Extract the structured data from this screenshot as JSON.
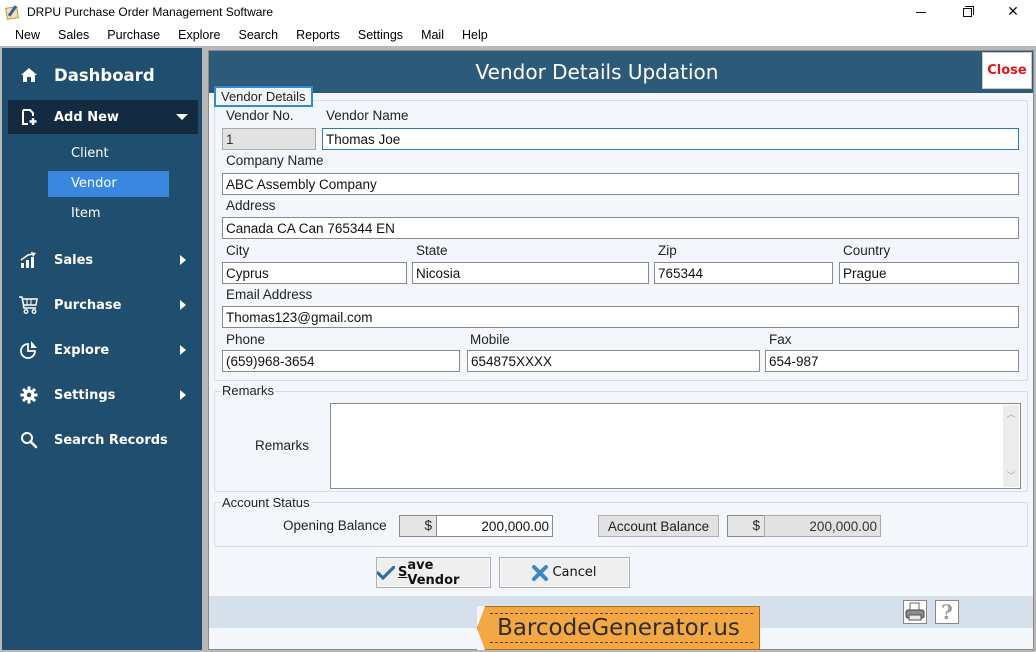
{
  "window": {
    "title": "DRPU Purchase Order Management Software",
    "controls": {
      "minimize": "minimize",
      "maximize": "restore",
      "close": "✕"
    }
  },
  "menubar": {
    "items": [
      "New",
      "Sales",
      "Purchase",
      "Explore",
      "Search",
      "Reports",
      "Settings",
      "Mail",
      "Help"
    ]
  },
  "sidebar": {
    "dashboard": "Dashboard",
    "add_new": "Add New",
    "add_new_items": [
      "Client",
      "Vendor",
      "Item"
    ],
    "selected_sub_item": "Vendor",
    "items": [
      {
        "label": "Sales",
        "icon": "chart-icon"
      },
      {
        "label": "Purchase",
        "icon": "cart-icon"
      },
      {
        "label": "Explore",
        "icon": "pie-chart-icon"
      },
      {
        "label": "Settings",
        "icon": "gear-icon"
      },
      {
        "label": "Search Records",
        "icon": "search-icon"
      }
    ]
  },
  "main": {
    "title": "Vendor Details Updation",
    "close_label": "Close",
    "vendor_details": {
      "legend": "Vendor Details",
      "vendor_no_label": "Vendor No.",
      "vendor_no": "1",
      "vendor_name_label": "Vendor Name",
      "vendor_name": "Thomas Joe",
      "company_name_label": "Company Name",
      "company_name": "ABC Assembly Company",
      "address_label": "Address",
      "address": "Canada CA Can 765344 EN",
      "city_label": "City",
      "city": "Cyprus",
      "state_label": "State",
      "state": "Nicosia",
      "zip_label": "Zip",
      "zip": "765344",
      "country_label": "Country",
      "country": "Prague",
      "email_label": "Email Address",
      "email": "Thomas123@gmail.com",
      "phone_label": "Phone",
      "phone": "(659)968-3654",
      "mobile_label": "Mobile",
      "mobile": "654875XXXX",
      "fax_label": "Fax",
      "fax": "654-987"
    },
    "remarks": {
      "legend": "Remarks",
      "label": "Remarks",
      "value": ""
    },
    "account_status": {
      "legend": "Account Status",
      "opening_balance_label": "Opening Balance",
      "currency_symbol": "$",
      "opening_balance": "200,000.00",
      "account_balance_button": "Account Balance",
      "account_balance": "200,000.00"
    },
    "buttons": {
      "save_first_letter": "S",
      "save_rest": "ave Vendor",
      "cancel": "Cancel"
    },
    "footer": {
      "brand": "BarcodeGenerator.us",
      "help_glyph": "?"
    }
  },
  "colors": {
    "sidebar_bg": "#1f4e6e",
    "sidebar_active": "#142a40",
    "sub_item_selected": "#3a87e0",
    "header_bg": "#2e5a7a",
    "close_text": "#e0141e",
    "brand_tag": "#f3a844"
  }
}
